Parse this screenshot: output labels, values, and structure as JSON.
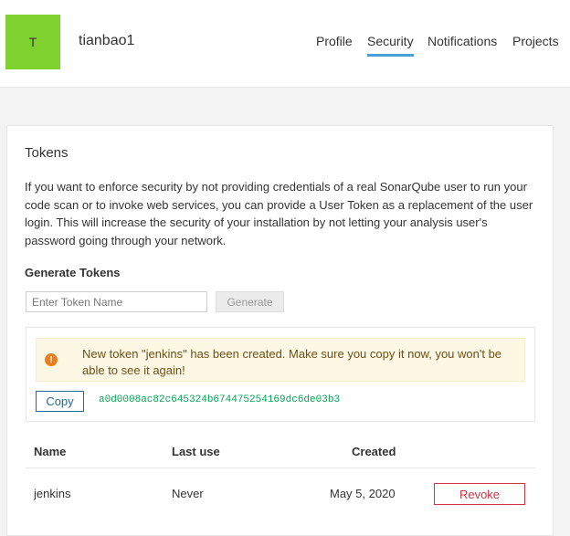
{
  "user": {
    "avatar_letter": "T",
    "avatar_color": "#7ed12e",
    "username": "tianbao1"
  },
  "nav": {
    "tabs": [
      {
        "label": "Profile",
        "active": false
      },
      {
        "label": "Security",
        "active": true
      },
      {
        "label": "Notifications",
        "active": false
      },
      {
        "label": "Projects",
        "active": false
      }
    ]
  },
  "tokens": {
    "title": "Tokens",
    "description": "If you want to enforce security by not providing credentials of a real SonarQube user to run your code scan or to invoke web services, you can provide a User Token as a replacement of the user login. This will increase the security of your installation by not letting your analysis user's password going through your network.",
    "generate_title": "Generate Tokens",
    "input_placeholder": "Enter Token Name",
    "generate_label": "Generate",
    "alert_text": "New token \"jenkins\" has been created. Make sure you copy it now, you won't be able to see it again!",
    "alert_icon": "exclamation-icon",
    "copy_label": "Copy",
    "token_value": "a0d0008ac82c645324b674475254169dc6de03b3"
  },
  "table": {
    "headers": {
      "name": "Name",
      "last_use": "Last use",
      "created": "Created"
    },
    "rows": [
      {
        "name": "jenkins",
        "last_use": "Never",
        "created": "May 5, 2020",
        "action": "Revoke"
      }
    ]
  },
  "colors": {
    "accent": "#4b9fd5",
    "danger": "#d4333f",
    "warning_icon": "#ed7d20",
    "token_text": "#00a651"
  }
}
